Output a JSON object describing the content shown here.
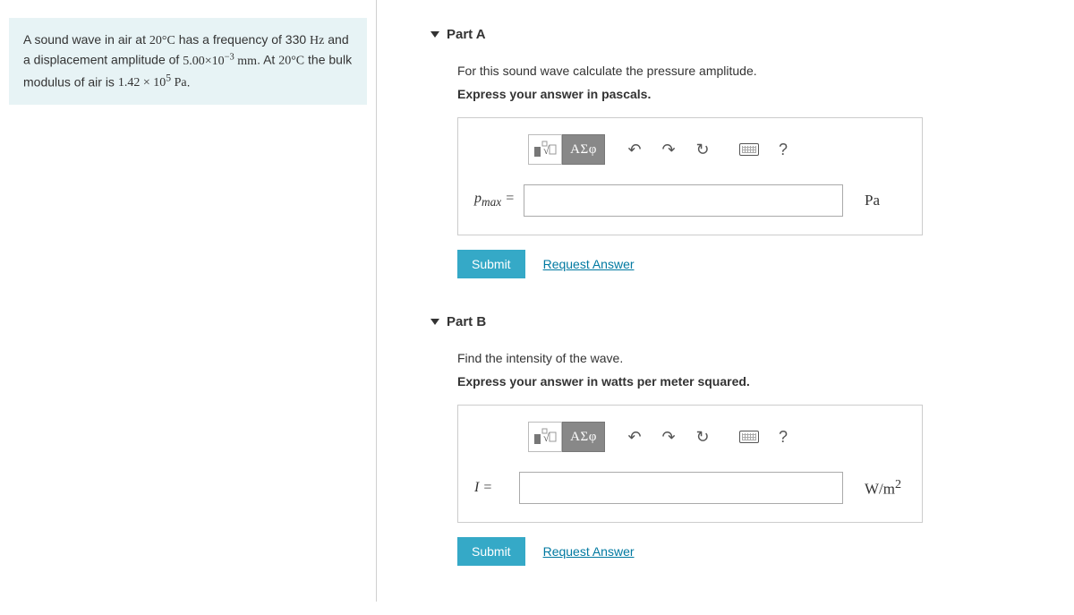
{
  "problem": {
    "html": "A sound wave in air at <span class='serif'>20°C</span> has a frequency of 330 <span class='serif'>Hz</span> and a displacement amplitude of <span class='serif'>5.00×10<sup class='neg'>−3</sup> mm</span>. At <span class='serif'>20°C</span> the bulk modulus of air is <span class='serif'>1.42 × 10<sup>5</sup> Pa</span>."
  },
  "parts": [
    {
      "title": "Part A",
      "prompt": "For this sound wave calculate the pressure amplitude.",
      "instruct": "Express your answer in pascals.",
      "variable_html": "<i>p</i><sub>max</sub> =",
      "unit_html": "Pa",
      "toolbar_greek": "ΑΣφ",
      "submit": "Submit",
      "request": "Request Answer"
    },
    {
      "title": "Part B",
      "prompt": "Find the intensity of the wave.",
      "instruct": "Express your answer in watts per meter squared.",
      "variable_html": "<i>I</i> =",
      "unit_html": "W/m<sup>2</sup>",
      "toolbar_greek": "ΑΣφ",
      "submit": "Submit",
      "request": "Request Answer"
    }
  ],
  "help_label": "?"
}
